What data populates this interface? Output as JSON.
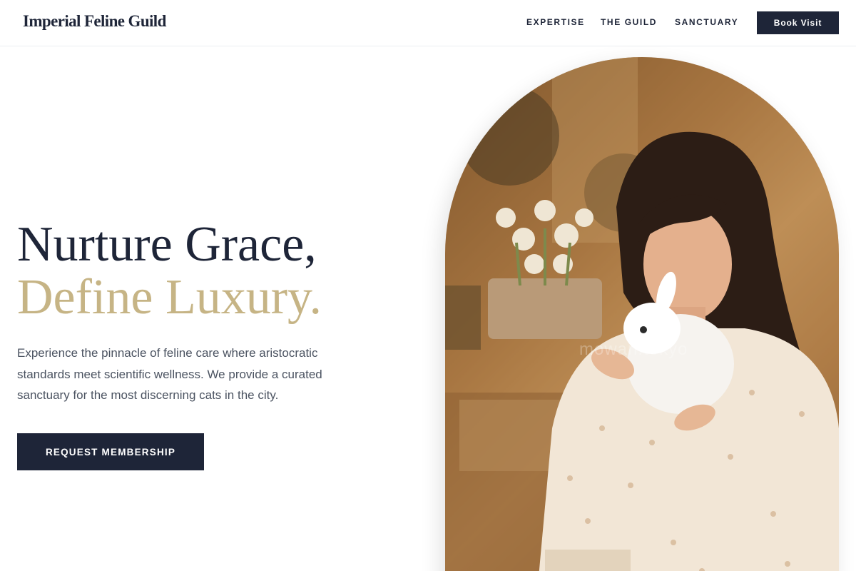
{
  "header": {
    "brand": "Imperial Feline Guild",
    "nav": [
      "EXPERTISE",
      "THE GUILD",
      "SANCTUARY"
    ],
    "book_label": "Book Visit"
  },
  "hero": {
    "headline_line1": "Nurture Grace,",
    "headline_line2": "Define Luxury.",
    "description": "Experience the pinnacle of feline care where aristocratic standards meet scientific wellness. We provide a curated sanctuary for the most discerning cats in the city.",
    "cta_label": "REQUEST MEMBERSHIP",
    "image_watermark": "mowan.tokyo"
  },
  "colors": {
    "navy": "#1e2538",
    "gold": "#c6b485",
    "body_text": "#4b5361"
  }
}
